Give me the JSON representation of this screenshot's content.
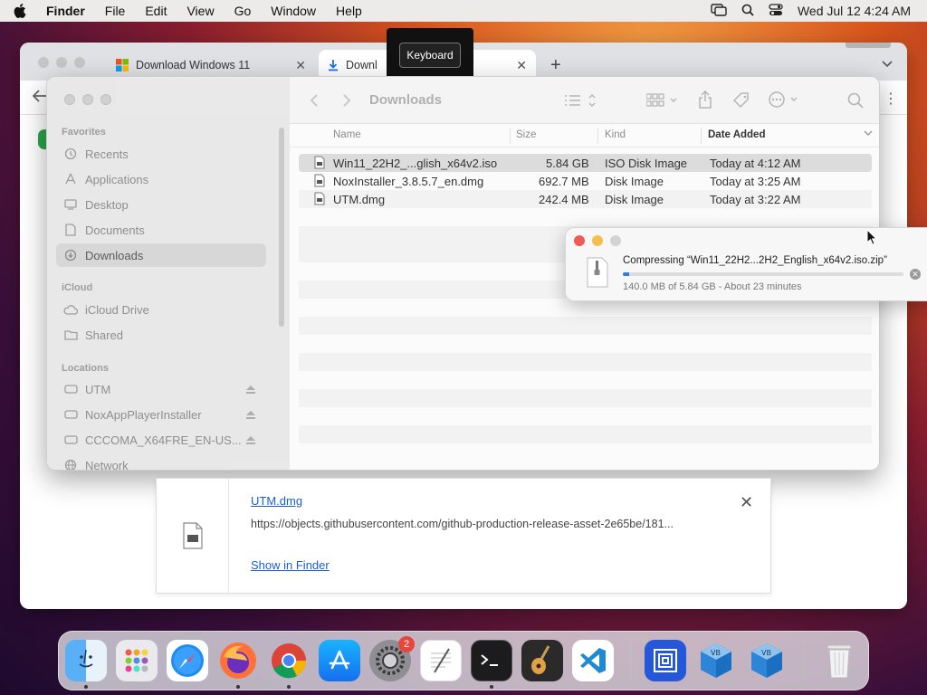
{
  "menubar": {
    "app": "Finder",
    "menus": [
      "File",
      "Edit",
      "View",
      "Go",
      "Window",
      "Help"
    ],
    "clock": "Wed Jul 12  4:24 AM"
  },
  "browser": {
    "tabs": [
      {
        "label": "Download Windows 11"
      },
      {
        "label": "Downl"
      }
    ],
    "new_tab": "+"
  },
  "keyboard_popup": {
    "label": "Keyboard"
  },
  "finder": {
    "title": "Downloads",
    "sidebar": {
      "favorites_header": "Favorites",
      "favorites": [
        "Recents",
        "Applications",
        "Desktop",
        "Documents",
        "Downloads"
      ],
      "icloud_header": "iCloud",
      "icloud": [
        "iCloud Drive",
        "Shared"
      ],
      "locations_header": "Locations",
      "locations": [
        "UTM",
        "NoxAppPlayerInstaller",
        "CCCOMA_X64FRE_EN-US...",
        "Network"
      ]
    },
    "columns": {
      "name": "Name",
      "size": "Size",
      "kind": "Kind",
      "date": "Date Added"
    },
    "files": [
      {
        "name": "Win11_22H2_...glish_x64v2.iso",
        "size": "5.84 GB",
        "kind": "ISO Disk Image",
        "date": "Today at 4:12 AM"
      },
      {
        "name": "NoxInstaller_3.8.5.7_en.dmg",
        "size": "692.7 MB",
        "kind": "Disk Image",
        "date": "Today at 3:25 AM"
      },
      {
        "name": "UTM.dmg",
        "size": "242.4 MB",
        "kind": "Disk Image",
        "date": "Today at 3:22 AM"
      }
    ]
  },
  "compress": {
    "title": "Compressing “Win11_22H2...2H2_English_x64v2.iso.zip”",
    "status": "140.0 MB of 5.84 GB - About 23 minutes",
    "progress": 0.024
  },
  "download": {
    "name": "UTM.dmg",
    "url": "https://objects.githubusercontent.com/github-production-release-asset-2e65be/181...",
    "show_in_finder": "Show in Finder"
  },
  "dock": {
    "settings_badge": "2"
  },
  "colors": {
    "accent": "#2a7bf6",
    "link": "#1a5fd1",
    "close": "#ee5b55",
    "minimize": "#f5bf4f"
  }
}
